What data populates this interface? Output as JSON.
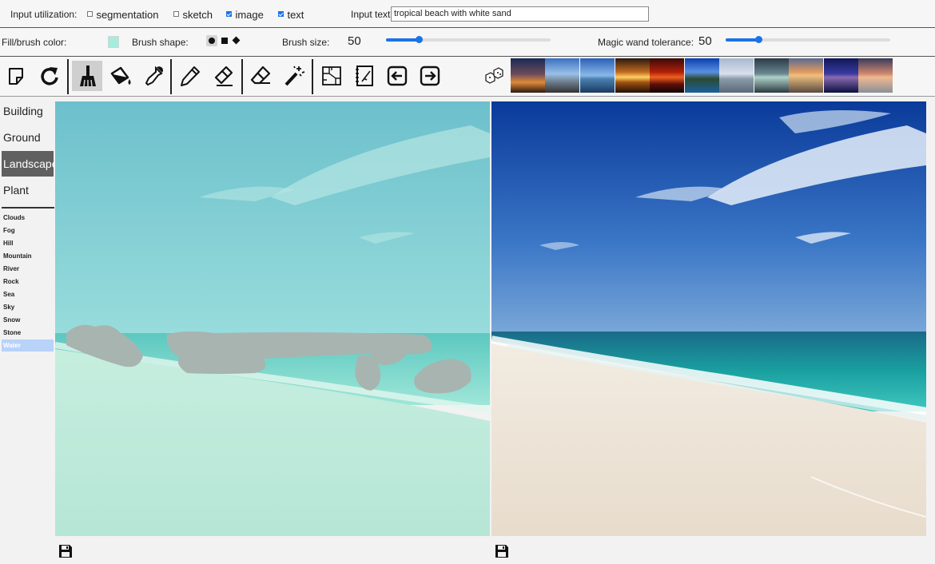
{
  "input_utilization": {
    "label": "Input utilization:",
    "options": [
      {
        "label": "segmentation",
        "checked": false
      },
      {
        "label": "sketch",
        "checked": false
      },
      {
        "label": "image",
        "checked": true
      },
      {
        "label": "text",
        "checked": true
      }
    ],
    "text_label": "Input text:",
    "text_value": "tropical beach with white sand"
  },
  "brush": {
    "fill_label": "Fill/brush color:",
    "fill_color": "#a4ecdc",
    "shape_label": "Brush shape:",
    "shapes": [
      "circle",
      "square",
      "diamond"
    ],
    "size_label": "Brush size:",
    "size_value": "50",
    "size_fraction": 0.2,
    "wand_label": "Magic wand tolerance:",
    "wand_value": "50",
    "wand_fraction": 0.2
  },
  "toolbar": {
    "tools": [
      "new-canvas",
      "redo",
      "brush",
      "fill-bucket",
      "color-picker",
      "pencil",
      "line-eraser",
      "eraser",
      "magic-wand",
      "segment-map",
      "sketch-pad",
      "previous",
      "next",
      "randomize"
    ],
    "active_tool": "brush",
    "sample_images": [
      "sunset-beach",
      "coastal-road",
      "calm-lake",
      "orange-sunset",
      "red-sunset",
      "mountain-lake",
      "grey-sea",
      "dusk-shore",
      "cloudy-sunset",
      "blue-night",
      "pink-dawn"
    ]
  },
  "sidebar": {
    "categories": [
      {
        "label": "Building",
        "selected": false
      },
      {
        "label": "Ground",
        "selected": false
      },
      {
        "label": "Landscape",
        "selected": true
      },
      {
        "label": "Plant",
        "selected": false
      }
    ],
    "subcategories": [
      {
        "label": "Clouds",
        "selected": false
      },
      {
        "label": "Fog",
        "selected": false
      },
      {
        "label": "Hill",
        "selected": false
      },
      {
        "label": "Mountain",
        "selected": false
      },
      {
        "label": "River",
        "selected": false
      },
      {
        "label": "Rock",
        "selected": false
      },
      {
        "label": "Sea",
        "selected": false
      },
      {
        "label": "Sky",
        "selected": false
      },
      {
        "label": "Snow",
        "selected": false
      },
      {
        "label": "Stone",
        "selected": false
      },
      {
        "label": "Water",
        "selected": true
      }
    ]
  },
  "colors": {
    "accent": "#1a73e8",
    "selected_category": "#606060",
    "selected_subcategory": "#b8d2f8"
  }
}
